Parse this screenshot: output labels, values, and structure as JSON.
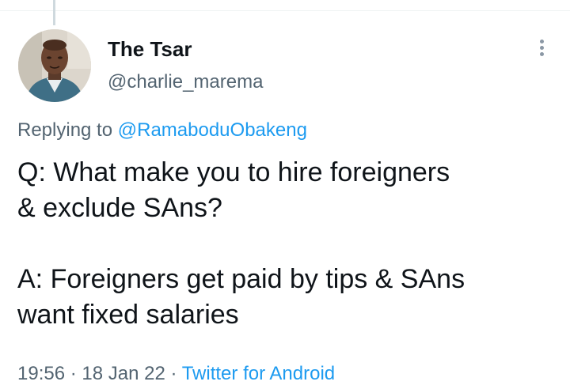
{
  "author": {
    "display_name": "The Tsar",
    "handle": "@charlie_marema"
  },
  "reply": {
    "prefix": "Replying to ",
    "mention": "@RamaboduObakeng"
  },
  "tweet": {
    "paragraph_1": "Q: What make you to hire foreigners\n& exclude SAns?",
    "paragraph_2": "A: Foreigners get paid by tips & SAns\nwant fixed salaries"
  },
  "meta": {
    "time": "19:56",
    "separator_1": " · ",
    "date": "18 Jan 22",
    "separator_2": " · ",
    "source": "Twitter for Android"
  },
  "icons": {
    "more": "more-vertical-icon",
    "avatar": "avatar"
  },
  "colors": {
    "accent": "#1d9bf0",
    "text": "#0f1419",
    "secondary": "#536471"
  }
}
